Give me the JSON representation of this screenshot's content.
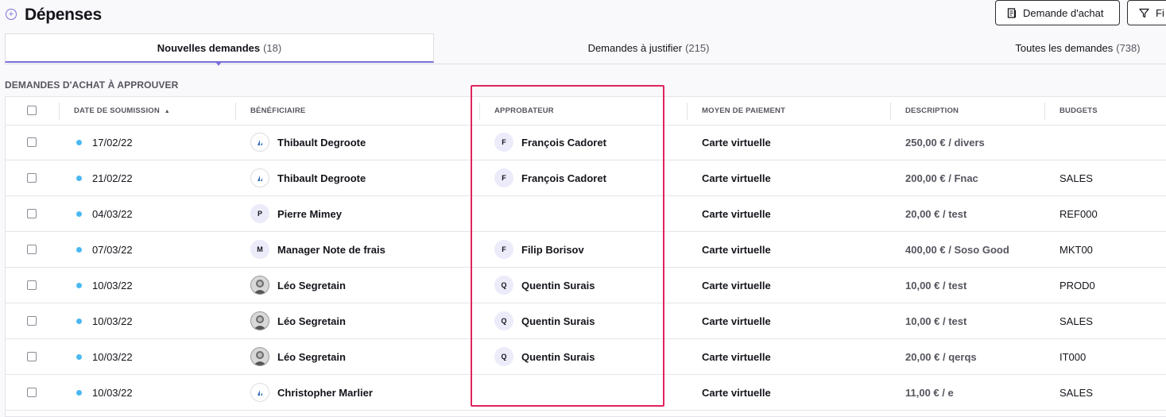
{
  "header": {
    "title": "Dépenses",
    "title_icon": "plus-circle-icon",
    "buttons": {
      "purchase_request": "Demande d'achat",
      "filter": "Fi"
    }
  },
  "tabs": [
    {
      "label": "Nouvelles demandes",
      "count": "(18)",
      "active": true
    },
    {
      "label": "Demandes à justifier",
      "count": "(215)",
      "active": false
    },
    {
      "label": "Toutes les demandes",
      "count": "(738)",
      "active": false
    }
  ],
  "section_title": "DEMANDES D'ACHAT À APPROUVER",
  "table": {
    "columns": {
      "date": "DATE DE SOUMISSION",
      "beneficiary": "BÉNÉFICIAIRE",
      "approver": "APPROBATEUR",
      "payment": "MOYEN DE PAIEMENT",
      "description": "DESCRIPTION",
      "budgets": "BUDGETS"
    },
    "rows": [
      {
        "date": "17/02/22",
        "beneficiary": "Thibault Degroote",
        "beneficiary_avatar": "logo",
        "approver": "François Cadoret",
        "approver_initial": "F",
        "payment": "Carte virtuelle",
        "description": "250,00 € / divers",
        "budget": ""
      },
      {
        "date": "21/02/22",
        "beneficiary": "Thibault Degroote",
        "beneficiary_avatar": "logo",
        "approver": "François Cadoret",
        "approver_initial": "F",
        "payment": "Carte virtuelle",
        "description": "200,00 € / Fnac",
        "budget": "SALES"
      },
      {
        "date": "04/03/22",
        "beneficiary": "Pierre Mimey",
        "beneficiary_avatar": "P",
        "approver": "",
        "approver_initial": "",
        "payment": "Carte virtuelle",
        "description": "20,00 € / test",
        "budget": "REF000"
      },
      {
        "date": "07/03/22",
        "beneficiary": "Manager Note de frais",
        "beneficiary_avatar": "M",
        "approver": "Filip Borisov",
        "approver_initial": "F",
        "payment": "Carte virtuelle",
        "description": "400,00 € / Soso Good",
        "budget": "MKT00"
      },
      {
        "date": "10/03/22",
        "beneficiary": "Léo Segretain",
        "beneficiary_avatar": "photo",
        "approver": "Quentin Surais",
        "approver_initial": "Q",
        "payment": "Carte virtuelle",
        "description": "10,00 € / test",
        "budget": "PROD0"
      },
      {
        "date": "10/03/22",
        "beneficiary": "Léo Segretain",
        "beneficiary_avatar": "photo",
        "approver": "Quentin Surais",
        "approver_initial": "Q",
        "payment": "Carte virtuelle",
        "description": "10,00 € / test",
        "budget": "SALES"
      },
      {
        "date": "10/03/22",
        "beneficiary": "Léo Segretain",
        "beneficiary_avatar": "photo",
        "approver": "Quentin Surais",
        "approver_initial": "Q",
        "payment": "Carte virtuelle",
        "description": "20,00 € / qerqs",
        "budget": "IT000"
      },
      {
        "date": "10/03/22",
        "beneficiary": "Christopher Marlier",
        "beneficiary_avatar": "logo",
        "approver": "",
        "approver_initial": "",
        "payment": "Carte virtuelle",
        "description": "11,00 € / e",
        "budget": "SALES"
      }
    ]
  },
  "colors": {
    "accent": "#7b6fd8",
    "status_dot": "#4bb8f0",
    "highlight_box": "#e0245e"
  }
}
